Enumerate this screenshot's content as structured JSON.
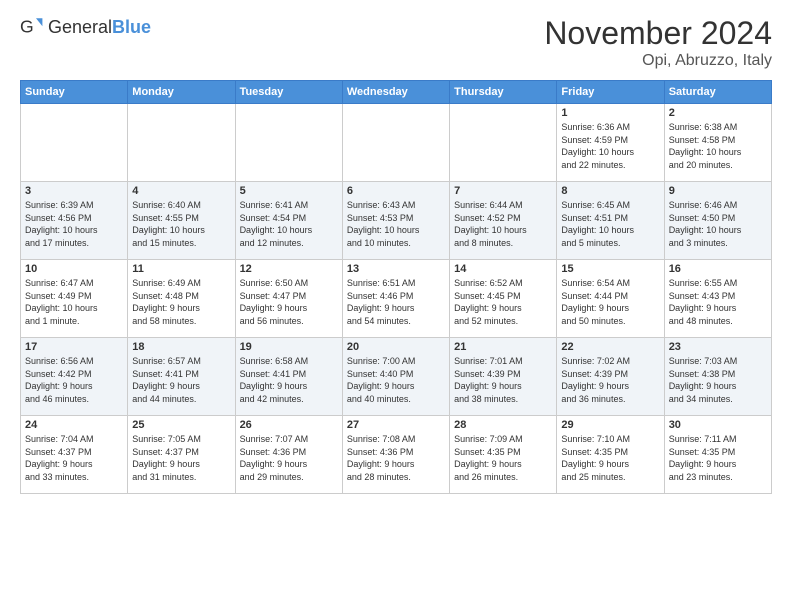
{
  "header": {
    "logo": {
      "text_general": "General",
      "text_blue": "Blue"
    },
    "title": "November 2024",
    "location": "Opi, Abruzzo, Italy"
  },
  "weekdays": [
    "Sunday",
    "Monday",
    "Tuesday",
    "Wednesday",
    "Thursday",
    "Friday",
    "Saturday"
  ],
  "weeks": [
    [
      {
        "day": "",
        "info": ""
      },
      {
        "day": "",
        "info": ""
      },
      {
        "day": "",
        "info": ""
      },
      {
        "day": "",
        "info": ""
      },
      {
        "day": "",
        "info": ""
      },
      {
        "day": "1",
        "info": "Sunrise: 6:36 AM\nSunset: 4:59 PM\nDaylight: 10 hours\nand 22 minutes."
      },
      {
        "day": "2",
        "info": "Sunrise: 6:38 AM\nSunset: 4:58 PM\nDaylight: 10 hours\nand 20 minutes."
      }
    ],
    [
      {
        "day": "3",
        "info": "Sunrise: 6:39 AM\nSunset: 4:56 PM\nDaylight: 10 hours\nand 17 minutes."
      },
      {
        "day": "4",
        "info": "Sunrise: 6:40 AM\nSunset: 4:55 PM\nDaylight: 10 hours\nand 15 minutes."
      },
      {
        "day": "5",
        "info": "Sunrise: 6:41 AM\nSunset: 4:54 PM\nDaylight: 10 hours\nand 12 minutes."
      },
      {
        "day": "6",
        "info": "Sunrise: 6:43 AM\nSunset: 4:53 PM\nDaylight: 10 hours\nand 10 minutes."
      },
      {
        "day": "7",
        "info": "Sunrise: 6:44 AM\nSunset: 4:52 PM\nDaylight: 10 hours\nand 8 minutes."
      },
      {
        "day": "8",
        "info": "Sunrise: 6:45 AM\nSunset: 4:51 PM\nDaylight: 10 hours\nand 5 minutes."
      },
      {
        "day": "9",
        "info": "Sunrise: 6:46 AM\nSunset: 4:50 PM\nDaylight: 10 hours\nand 3 minutes."
      }
    ],
    [
      {
        "day": "10",
        "info": "Sunrise: 6:47 AM\nSunset: 4:49 PM\nDaylight: 10 hours\nand 1 minute."
      },
      {
        "day": "11",
        "info": "Sunrise: 6:49 AM\nSunset: 4:48 PM\nDaylight: 9 hours\nand 58 minutes."
      },
      {
        "day": "12",
        "info": "Sunrise: 6:50 AM\nSunset: 4:47 PM\nDaylight: 9 hours\nand 56 minutes."
      },
      {
        "day": "13",
        "info": "Sunrise: 6:51 AM\nSunset: 4:46 PM\nDaylight: 9 hours\nand 54 minutes."
      },
      {
        "day": "14",
        "info": "Sunrise: 6:52 AM\nSunset: 4:45 PM\nDaylight: 9 hours\nand 52 minutes."
      },
      {
        "day": "15",
        "info": "Sunrise: 6:54 AM\nSunset: 4:44 PM\nDaylight: 9 hours\nand 50 minutes."
      },
      {
        "day": "16",
        "info": "Sunrise: 6:55 AM\nSunset: 4:43 PM\nDaylight: 9 hours\nand 48 minutes."
      }
    ],
    [
      {
        "day": "17",
        "info": "Sunrise: 6:56 AM\nSunset: 4:42 PM\nDaylight: 9 hours\nand 46 minutes."
      },
      {
        "day": "18",
        "info": "Sunrise: 6:57 AM\nSunset: 4:41 PM\nDaylight: 9 hours\nand 44 minutes."
      },
      {
        "day": "19",
        "info": "Sunrise: 6:58 AM\nSunset: 4:41 PM\nDaylight: 9 hours\nand 42 minutes."
      },
      {
        "day": "20",
        "info": "Sunrise: 7:00 AM\nSunset: 4:40 PM\nDaylight: 9 hours\nand 40 minutes."
      },
      {
        "day": "21",
        "info": "Sunrise: 7:01 AM\nSunset: 4:39 PM\nDaylight: 9 hours\nand 38 minutes."
      },
      {
        "day": "22",
        "info": "Sunrise: 7:02 AM\nSunset: 4:39 PM\nDaylight: 9 hours\nand 36 minutes."
      },
      {
        "day": "23",
        "info": "Sunrise: 7:03 AM\nSunset: 4:38 PM\nDaylight: 9 hours\nand 34 minutes."
      }
    ],
    [
      {
        "day": "24",
        "info": "Sunrise: 7:04 AM\nSunset: 4:37 PM\nDaylight: 9 hours\nand 33 minutes."
      },
      {
        "day": "25",
        "info": "Sunrise: 7:05 AM\nSunset: 4:37 PM\nDaylight: 9 hours\nand 31 minutes."
      },
      {
        "day": "26",
        "info": "Sunrise: 7:07 AM\nSunset: 4:36 PM\nDaylight: 9 hours\nand 29 minutes."
      },
      {
        "day": "27",
        "info": "Sunrise: 7:08 AM\nSunset: 4:36 PM\nDaylight: 9 hours\nand 28 minutes."
      },
      {
        "day": "28",
        "info": "Sunrise: 7:09 AM\nSunset: 4:35 PM\nDaylight: 9 hours\nand 26 minutes."
      },
      {
        "day": "29",
        "info": "Sunrise: 7:10 AM\nSunset: 4:35 PM\nDaylight: 9 hours\nand 25 minutes."
      },
      {
        "day": "30",
        "info": "Sunrise: 7:11 AM\nSunset: 4:35 PM\nDaylight: 9 hours\nand 23 minutes."
      }
    ]
  ]
}
